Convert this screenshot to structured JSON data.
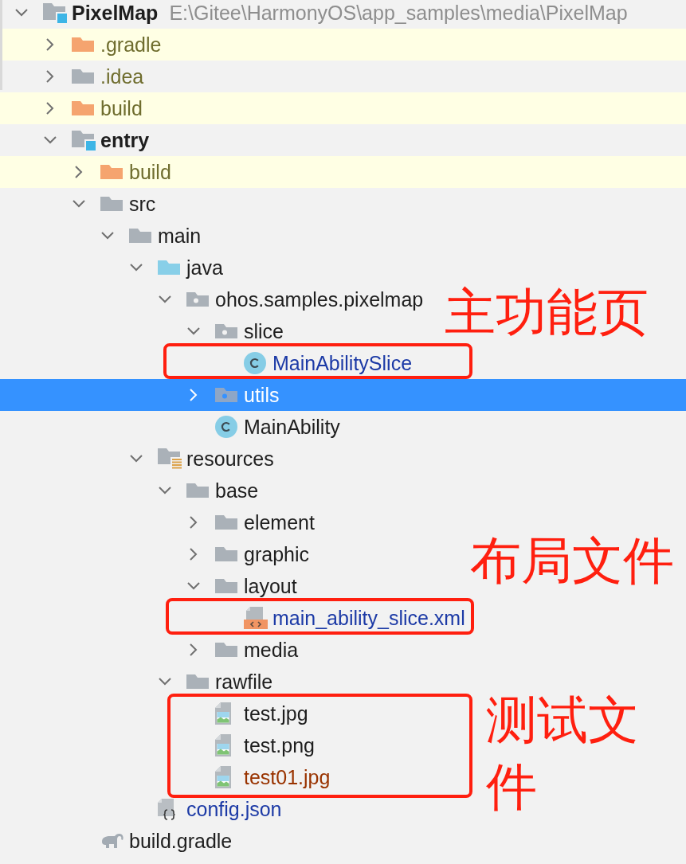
{
  "project_tree": {
    "items": [
      {
        "name": "PixelMap",
        "path": "E:\\Gitee\\HarmonyOS\\app_samples\\media\\PixelMap",
        "kind": "module",
        "color": "#1e1e1e",
        "expanded": true,
        "selected": false,
        "children": [
          {
            "name": ".gradle",
            "kind": "excluded-folder",
            "color": "#6f6d2e",
            "expanded": false,
            "selected": false
          },
          {
            "name": ".idea",
            "kind": "folder",
            "color": "#6f6d2e",
            "expanded": false,
            "selected": false
          },
          {
            "name": "build",
            "kind": "excluded-folder",
            "color": "#6f6d2e",
            "expanded": false,
            "selected": false
          },
          {
            "name": "entry",
            "kind": "module",
            "color": "#1e1e1e",
            "expanded": true,
            "selected": false,
            "children": [
              {
                "name": "build",
                "kind": "excluded-folder",
                "color": "#6f6d2e",
                "expanded": false,
                "selected": false
              },
              {
                "name": "src",
                "kind": "folder",
                "color": "#1e1e1e",
                "expanded": true,
                "selected": false,
                "children": [
                  {
                    "name": "main",
                    "kind": "folder",
                    "color": "#1e1e1e",
                    "expanded": true,
                    "selected": false,
                    "children": [
                      {
                        "name": "java",
                        "kind": "source-folder",
                        "color": "#1e1e1e",
                        "expanded": true,
                        "selected": false,
                        "children": [
                          {
                            "name": "ohos.samples.pixelmap",
                            "kind": "package",
                            "color": "#1e1e1e",
                            "expanded": true,
                            "selected": false,
                            "children": [
                              {
                                "name": "slice",
                                "kind": "package",
                                "color": "#1e1e1e",
                                "expanded": true,
                                "selected": false,
                                "children": [
                                  {
                                    "name": "MainAbilitySlice",
                                    "kind": "class",
                                    "color": "#1c3aa6",
                                    "selected": false
                                  }
                                ]
                              },
                              {
                                "name": "utils",
                                "kind": "package",
                                "expanded": false,
                                "selected": true
                              },
                              {
                                "name": "MainAbility",
                                "kind": "class",
                                "color": "#1e1e1e",
                                "selected": false
                              }
                            ]
                          }
                        ]
                      },
                      {
                        "name": "resources",
                        "kind": "resource-folder",
                        "color": "#1e1e1e",
                        "expanded": true,
                        "selected": false,
                        "children": [
                          {
                            "name": "base",
                            "kind": "folder",
                            "color": "#1e1e1e",
                            "expanded": true,
                            "selected": false,
                            "children": [
                              {
                                "name": "element",
                                "kind": "folder",
                                "color": "#1e1e1e",
                                "expanded": false,
                                "selected": false
                              },
                              {
                                "name": "graphic",
                                "kind": "folder",
                                "color": "#1e1e1e",
                                "expanded": false,
                                "selected": false
                              },
                              {
                                "name": "layout",
                                "kind": "folder",
                                "color": "#1e1e1e",
                                "expanded": true,
                                "selected": false,
                                "children": [
                                  {
                                    "name": "main_ability_slice.xml",
                                    "kind": "xml",
                                    "color": "#1c3aa6",
                                    "selected": false
                                  }
                                ]
                              },
                              {
                                "name": "media",
                                "kind": "folder",
                                "color": "#1e1e1e",
                                "expanded": false,
                                "selected": false
                              }
                            ]
                          },
                          {
                            "name": "rawfile",
                            "kind": "folder",
                            "color": "#1e1e1e",
                            "expanded": true,
                            "selected": false,
                            "children": [
                              {
                                "name": "test.jpg",
                                "kind": "image",
                                "color": "#1e1e1e",
                                "selected": false
                              },
                              {
                                "name": "test.png",
                                "kind": "image",
                                "color": "#1e1e1e",
                                "selected": false
                              },
                              {
                                "name": "test01.jpg",
                                "kind": "image",
                                "color": "#993300",
                                "selected": false
                              }
                            ]
                          }
                        ]
                      },
                      {
                        "name": "config.json",
                        "kind": "json",
                        "color": "#1c3aa6",
                        "selected": false
                      }
                    ]
                  }
                ]
              },
              {
                "name": "build.gradle",
                "kind": "gradle",
                "color": "#1e1e1e",
                "selected": false
              }
            ]
          }
        ]
      }
    ]
  },
  "annotations": [
    {
      "text": "主功能页"
    },
    {
      "text": "布局文件"
    },
    {
      "text": "测试文件"
    }
  ]
}
